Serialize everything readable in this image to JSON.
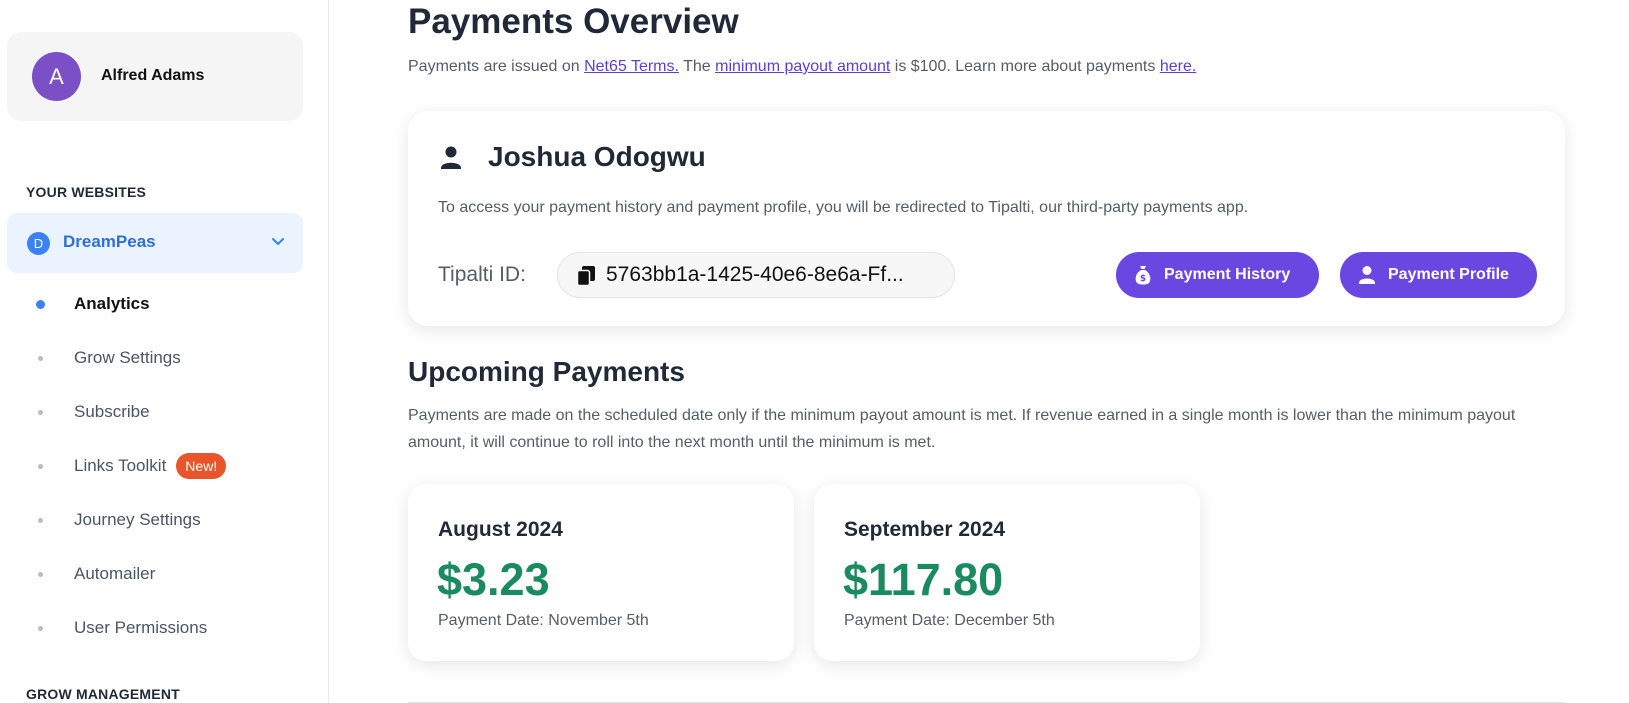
{
  "user": {
    "avatar_letter": "A",
    "name": "Alfred Adams"
  },
  "sidebar": {
    "websites_heading": "YOUR WEBSITES",
    "site": {
      "badge": "D",
      "label": "DreamPeas"
    },
    "nav_items": [
      {
        "label": "Analytics",
        "active": true
      },
      {
        "label": "Grow Settings"
      },
      {
        "label": "Subscribe"
      },
      {
        "label": "Links Toolkit",
        "badge": "New!"
      },
      {
        "label": "Journey Settings"
      },
      {
        "label": "Automailer"
      },
      {
        "label": "User Permissions"
      }
    ],
    "management_heading": "GROW MANAGEMENT"
  },
  "page": {
    "title": "Payments Overview",
    "subtitle_parts": {
      "p1": "Payments are issued on ",
      "link1": "Net65 Terms.",
      "p2": " The ",
      "link2": "minimum payout amount",
      "p3": " is $100. Learn more about payments ",
      "link3": "here."
    }
  },
  "profile": {
    "name": "Joshua Odogwu",
    "description": "To access your payment history and payment profile, you will be redirected to Tipalti, our third-party payments app.",
    "tipalti_label": "Tipalti ID:",
    "tipalti_id": "5763bb1a-1425-40e6-8e6a-Ff...",
    "history_button": "Payment History",
    "profile_button": "Payment Profile"
  },
  "upcoming": {
    "title": "Upcoming Payments",
    "description": "Payments are made on the scheduled date only if the minimum payout amount is met. If revenue earned in a single month is lower than the minimum payout amount, it will continue to roll into the next month until the minimum is met.",
    "payments": [
      {
        "month": "August 2024",
        "amount": "$3.23",
        "date": "Payment Date: November 5th"
      },
      {
        "month": "September 2024",
        "amount": "$117.80",
        "date": "Payment Date: December 5th"
      }
    ]
  },
  "colors": {
    "accent": "#6a47e0",
    "money": "#1a8a5f",
    "active_blue": "#3b82f6",
    "new_badge": "#e8552b"
  }
}
